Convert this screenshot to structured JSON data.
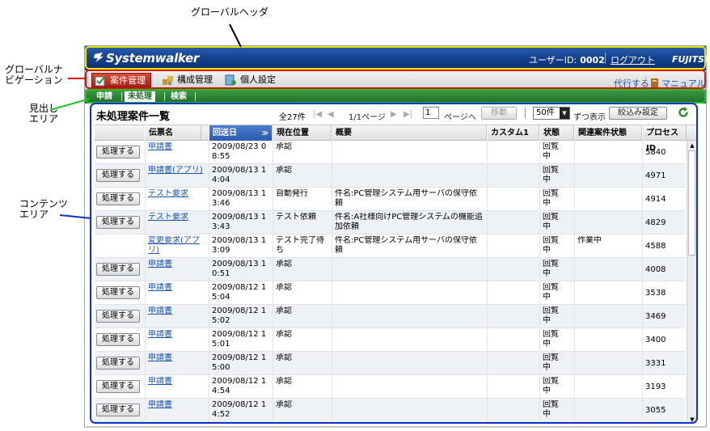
{
  "annotations": {
    "global_header": "グローバルヘッダ",
    "global_nav_line1": "グローバルナ",
    "global_nav_line2": "ビゲーション",
    "heading_area_line1": "見出し",
    "heading_area_line2": "エリア",
    "content_area_line1": "コンテンツ",
    "content_area_line2": "エリア"
  },
  "colors": {
    "header": "#123f8a",
    "nav_active": "#c0392b",
    "heading_bar": "#2f8a3a",
    "highlight_yellow": "#e6e600",
    "highlight_red": "#e01010",
    "highlight_green": "#20c020",
    "highlight_blue": "#1030d0",
    "link": "#1a55b0"
  },
  "header": {
    "logo": "Systemwalker",
    "user_label": "ユーザーID:",
    "user_id": "0002",
    "logout": "ログアウト",
    "brand": "FUJITSU"
  },
  "nav": {
    "tabs": [
      {
        "label": "案件管理",
        "icon": "check-icon",
        "active": true
      },
      {
        "label": "構成管理",
        "icon": "config-icon",
        "active": false
      },
      {
        "label": "個人設定",
        "icon": "settings-icon",
        "active": false
      }
    ],
    "links": [
      "代行する",
      "マニュアル"
    ]
  },
  "heading": {
    "tabs": [
      "申請",
      "未処理",
      "検索"
    ],
    "active": "未処理"
  },
  "content": {
    "title": "未処理案件一覧",
    "total": "全27件",
    "page_info": "1/1ページ",
    "page_input": "1",
    "page_suffix": "ページへ",
    "move_button": "移動",
    "per_page": "50件",
    "per_page_suffix": "ずつ表示",
    "filter_button": "絞込み設定"
  },
  "table": {
    "columns": [
      "伝票名",
      "回送日",
      "現在位置",
      "概要",
      "カスタム1",
      "状態",
      "関連案件状態",
      "プロセスID"
    ],
    "sorted_column": "回送日",
    "process_button": "処理する",
    "rows": [
      {
        "button": true,
        "slip": "申請書",
        "date": "2009/08/23 0 8:55",
        "position": "承認",
        "summary": "",
        "custom": "",
        "status": "回覧中",
        "related": "",
        "pid": "5840"
      },
      {
        "button": true,
        "slip": "申請書(アプリ)",
        "date": "2009/08/13 1 4:04",
        "position": "承認",
        "summary": "",
        "custom": "",
        "status": "回覧中",
        "related": "",
        "pid": "4971"
      },
      {
        "button": true,
        "slip": "テスト要求",
        "date": "2009/08/13 1 3:46",
        "position": "自動発行",
        "summary": "件名:PC管理システム用サーバの保守依頼",
        "custom": "",
        "status": "回覧中",
        "related": "",
        "pid": "4914"
      },
      {
        "button": true,
        "slip": "テスト要求",
        "date": "2009/08/13 1 3:43",
        "position": "テスト依頼",
        "summary": "件名:A社様向けPC管理システムの機能追加依頼",
        "custom": "",
        "status": "回覧中",
        "related": "",
        "pid": "4829"
      },
      {
        "button": false,
        "slip": "変更要求(アプリ)",
        "date": "2009/08/13 1 3:09",
        "position": "テスト完了待ち",
        "summary": "件名:PC管理システム用サーバの保守依頼",
        "custom": "",
        "status": "回覧中",
        "related": "作業中",
        "pid": "4588"
      },
      {
        "button": true,
        "slip": "申請書",
        "date": "2009/08/13 1 0:51",
        "position": "承認",
        "summary": "",
        "custom": "",
        "status": "回覧中",
        "related": "",
        "pid": "4008"
      },
      {
        "button": true,
        "slip": "申請書",
        "date": "2009/08/12 1 5:04",
        "position": "承認",
        "summary": "",
        "custom": "",
        "status": "回覧中",
        "related": "",
        "pid": "3538"
      },
      {
        "button": true,
        "slip": "申請書",
        "date": "2009/08/12 1 5:02",
        "position": "承認",
        "summary": "",
        "custom": "",
        "status": "回覧中",
        "related": "",
        "pid": "3469"
      },
      {
        "button": true,
        "slip": "申請書",
        "date": "2009/08/12 1 5:01",
        "position": "承認",
        "summary": "",
        "custom": "",
        "status": "回覧中",
        "related": "",
        "pid": "3400"
      },
      {
        "button": true,
        "slip": "申請書",
        "date": "2009/08/12 1 5:00",
        "position": "承認",
        "summary": "",
        "custom": "",
        "status": "回覧中",
        "related": "",
        "pid": "3331"
      },
      {
        "button": true,
        "slip": "申請書",
        "date": "2009/08/12 1 4:54",
        "position": "承認",
        "summary": "",
        "custom": "",
        "status": "回覧中",
        "related": "",
        "pid": "3193"
      },
      {
        "button": true,
        "slip": "申請書",
        "date": "2009/08/12 1 4:52",
        "position": "承認",
        "summary": "",
        "custom": "",
        "status": "回覧中",
        "related": "",
        "pid": "3055"
      }
    ]
  }
}
